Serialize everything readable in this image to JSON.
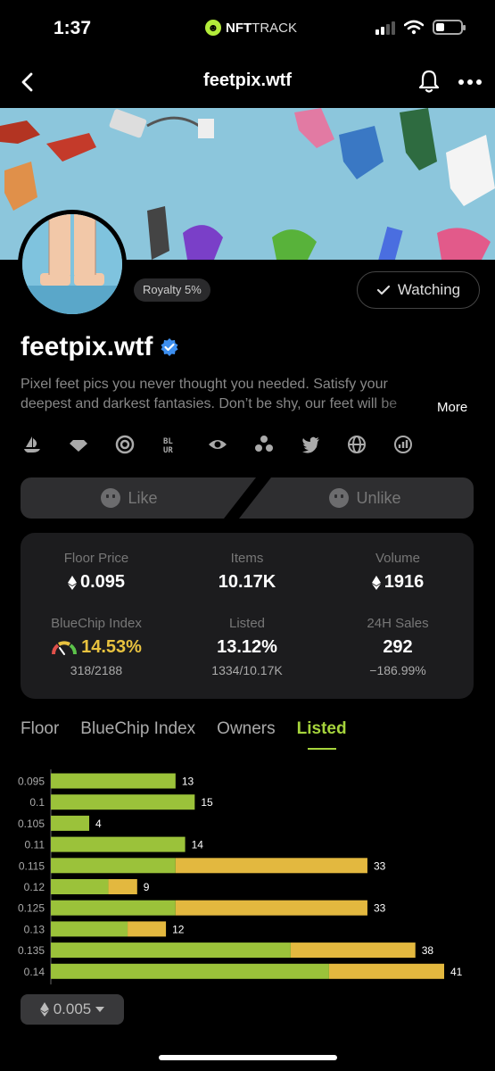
{
  "status_bar": {
    "time": "1:37",
    "app_name_strong": "NFT",
    "app_name_light": "TRACK"
  },
  "nav": {
    "title": "feetpix.wtf"
  },
  "collection": {
    "royalty": "Royalty 5%",
    "watch_label": "Watching",
    "name": "feetpix.wtf",
    "description": "Pixel feet pics you never thought you needed. Satisfy your deepest and darkest fantasies. Don’t be shy, our feet will be",
    "more_label": "More"
  },
  "socials": [
    "opensea-icon",
    "diamond-icon",
    "looksrare-icon",
    "blur-icon",
    "eye-icon",
    "network-icon",
    "twitter-icon",
    "globe-icon",
    "chart-icon"
  ],
  "reactions": {
    "like_label": "Like",
    "unlike_label": "Unlike"
  },
  "stats": {
    "floor_price": {
      "label": "Floor Price",
      "value": "0.095"
    },
    "items": {
      "label": "Items",
      "value": "10.17K"
    },
    "volume": {
      "label": "Volume",
      "value": "1916"
    },
    "bluechip": {
      "label": "BlueChip Index",
      "value": "14.53%",
      "sub": "318/2188"
    },
    "listed": {
      "label": "Listed",
      "value": "13.12%",
      "sub": "1334/10.17K"
    },
    "sales24h": {
      "label": "24H Sales",
      "value": "292",
      "sub": "−186.99%"
    }
  },
  "tabs": [
    {
      "label": "Floor",
      "active": false
    },
    {
      "label": "BlueChip Index",
      "active": false
    },
    {
      "label": "Owners",
      "active": false
    },
    {
      "label": "Listed",
      "active": true
    }
  ],
  "colors": {
    "accent": "#a6d43c",
    "bar_green": "#9bc23a",
    "bar_yellow": "#e3b83f",
    "card_bg": "#1c1c1e"
  },
  "chart_data": {
    "type": "bar",
    "orientation": "horizontal",
    "stacked": true,
    "categories": [
      "0.095",
      "0.1",
      "0.105",
      "0.11",
      "0.115",
      "0.12",
      "0.125",
      "0.13",
      "0.135",
      "0.14"
    ],
    "totals": [
      13,
      15,
      4,
      14,
      33,
      9,
      33,
      12,
      38,
      41
    ],
    "series": [
      {
        "color": "#9bc23a",
        "values": [
          13,
          15,
          4,
          14,
          13,
          6,
          13,
          8,
          25,
          29
        ]
      },
      {
        "color": "#e3b83f",
        "values": [
          0,
          0,
          0,
          0,
          20,
          3,
          20,
          4,
          13,
          12
        ]
      }
    ],
    "xlim": [
      0,
      41
    ]
  },
  "price_step": "0.005"
}
